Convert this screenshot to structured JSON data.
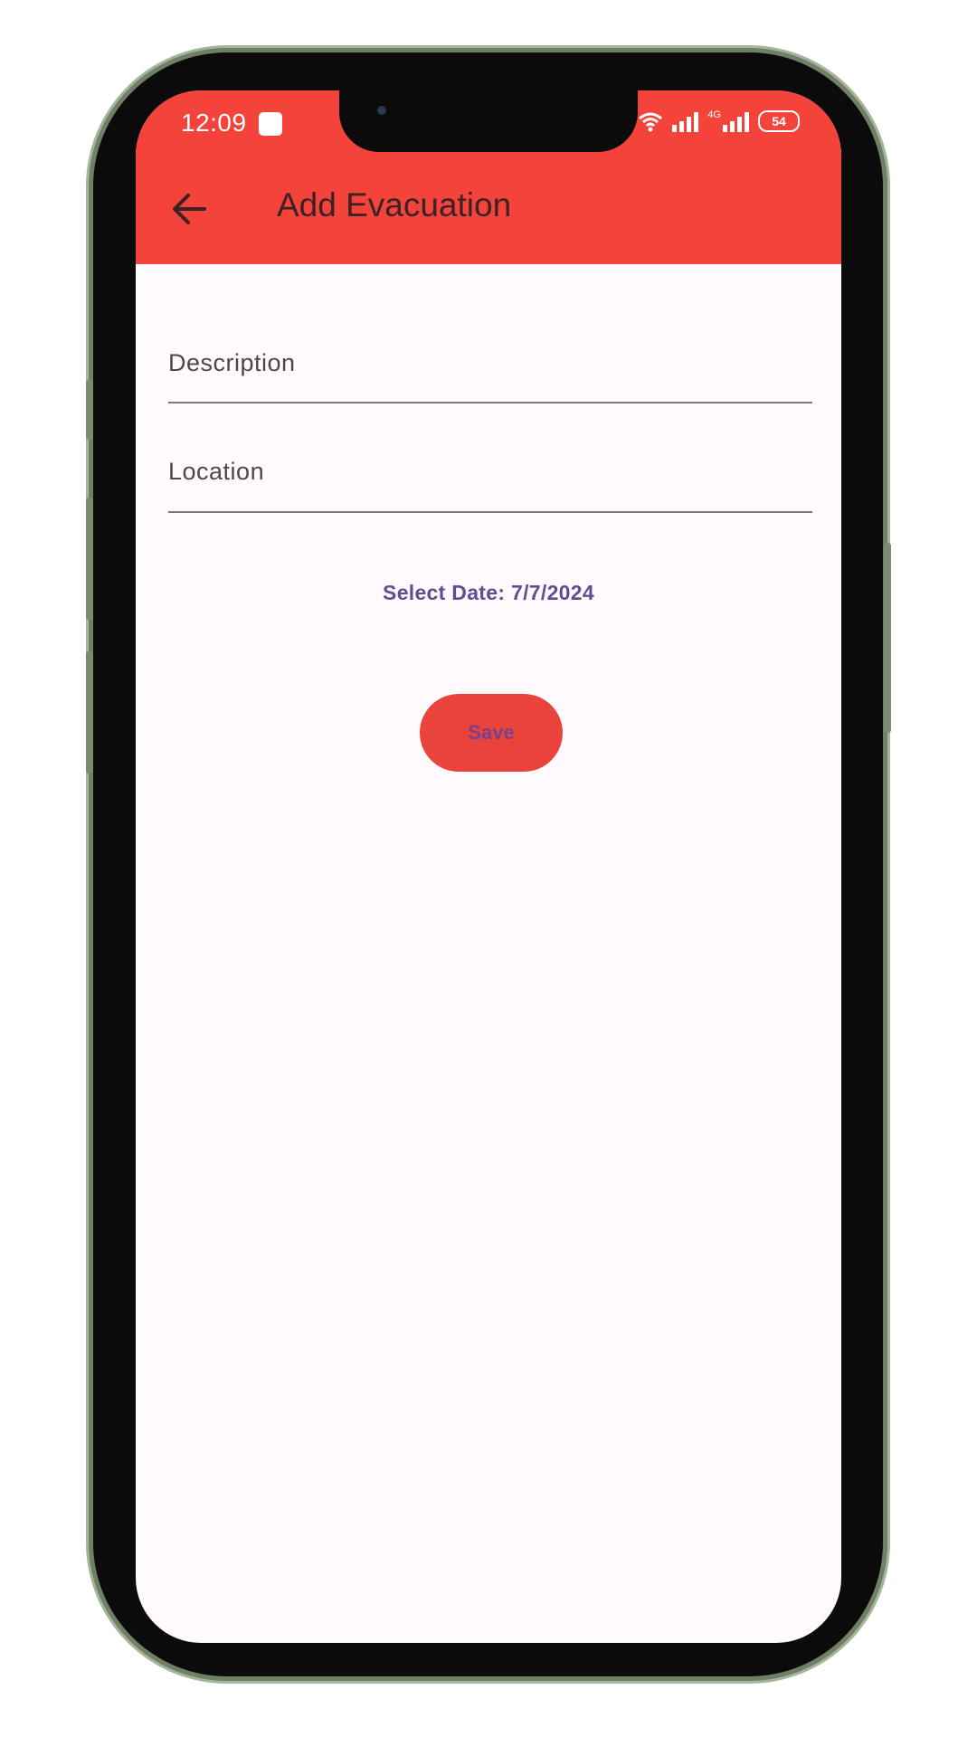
{
  "status_bar": {
    "time": "12:09",
    "network_label": "4G",
    "battery": "54"
  },
  "app_bar": {
    "title": "Add Evacuation",
    "back_icon": "arrow-back-icon"
  },
  "form": {
    "description_label": "Description",
    "description_value": "",
    "location_label": "Location",
    "location_value": "",
    "date_button_label": "Select Date: 7/7/2024",
    "save_label": "Save"
  },
  "colors": {
    "app_bar": "#f4433a",
    "save_button": "#ea433c",
    "accent_text": "#5c4f93",
    "background": "#fefafe"
  }
}
